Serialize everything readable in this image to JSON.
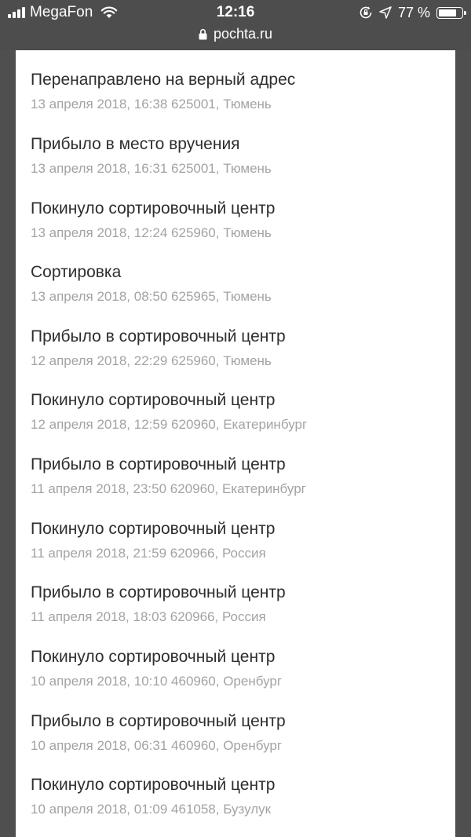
{
  "status_bar": {
    "carrier": "MegaFon",
    "time": "12:16",
    "battery_percent": "77 %",
    "battery_level": 0.77
  },
  "url_bar": {
    "url": "pochta.ru"
  },
  "events": [
    {
      "title": "Перенаправлено на верный адрес",
      "date": "13 апреля 2018, 16:38",
      "location": "625001, Тюмень"
    },
    {
      "title": "Прибыло в место вручения",
      "date": "13 апреля 2018, 16:31",
      "location": "625001, Тюмень"
    },
    {
      "title": "Покинуло сортировочный центр",
      "date": "13 апреля 2018, 12:24",
      "location": "625960, Тюмень"
    },
    {
      "title": "Сортировка",
      "date": "13 апреля 2018, 08:50",
      "location": "625965, Тюмень"
    },
    {
      "title": "Прибыло в сортировочный центр",
      "date": "12 апреля 2018, 22:29",
      "location": "625960, Тюмень"
    },
    {
      "title": "Покинуло сортировочный центр",
      "date": "12 апреля 2018, 12:59",
      "location": "620960, Екатеринбург"
    },
    {
      "title": "Прибыло в сортировочный центр",
      "date": "11 апреля 2018, 23:50",
      "location": "620960, Екатеринбург"
    },
    {
      "title": "Покинуло сортировочный центр",
      "date": "11 апреля 2018, 21:59",
      "location": "620966, Россия"
    },
    {
      "title": "Прибыло в сортировочный центр",
      "date": "11 апреля 2018, 18:03",
      "location": "620966, Россия"
    },
    {
      "title": "Покинуло сортировочный центр",
      "date": "10 апреля 2018, 10:10",
      "location": "460960, Оренбург"
    },
    {
      "title": "Прибыло в сортировочный центр",
      "date": "10 апреля 2018, 06:31",
      "location": "460960, Оренбург"
    },
    {
      "title": "Покинуло сортировочный центр",
      "date": "10 апреля 2018, 01:09",
      "location": "461058, Бузулук"
    }
  ]
}
